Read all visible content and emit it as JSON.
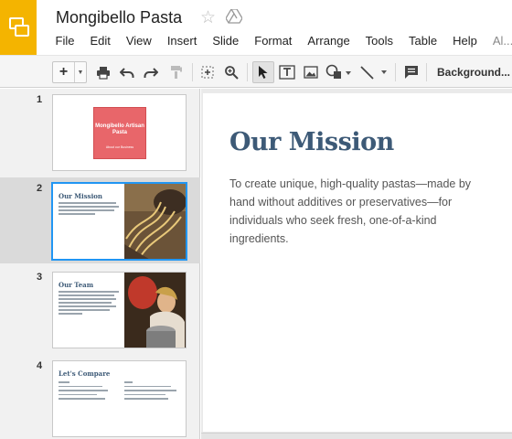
{
  "document": {
    "title": "Mongibello Pasta"
  },
  "menu": [
    "File",
    "Edit",
    "View",
    "Insert",
    "Slide",
    "Format",
    "Arrange",
    "Tools",
    "Table",
    "Help",
    "Al..."
  ],
  "toolbar": {
    "new_slide_label": "+",
    "background_label": "Background..."
  },
  "filmstrip": [
    {
      "number": "1",
      "title": "Mongibello Artisan Pasta",
      "subtitle": "About our Business"
    },
    {
      "number": "2",
      "title": "Our Mission"
    },
    {
      "number": "3",
      "title": "Our Team"
    },
    {
      "number": "4",
      "title": "Let's Compare"
    }
  ],
  "slide": {
    "title": "Our Mission",
    "body": "To create unique, high-quality pastas—made by hand without additives or preservatives—for individuals who seek fresh, one-of-a-kind ingredients."
  },
  "colors": {
    "logo": "#f4b400",
    "title_slide_card": "#e8666a",
    "heading": "#3d5a77",
    "selection": "#2196f3"
  },
  "icons": [
    "slides-logo-icon",
    "star-icon",
    "drive-icon",
    "print-icon",
    "undo-icon",
    "redo-icon",
    "paint-format-icon",
    "zoom-fit-icon",
    "zoom-icon",
    "select-icon",
    "text-box-icon",
    "image-icon",
    "shape-icon",
    "line-icon",
    "comment-icon"
  ]
}
